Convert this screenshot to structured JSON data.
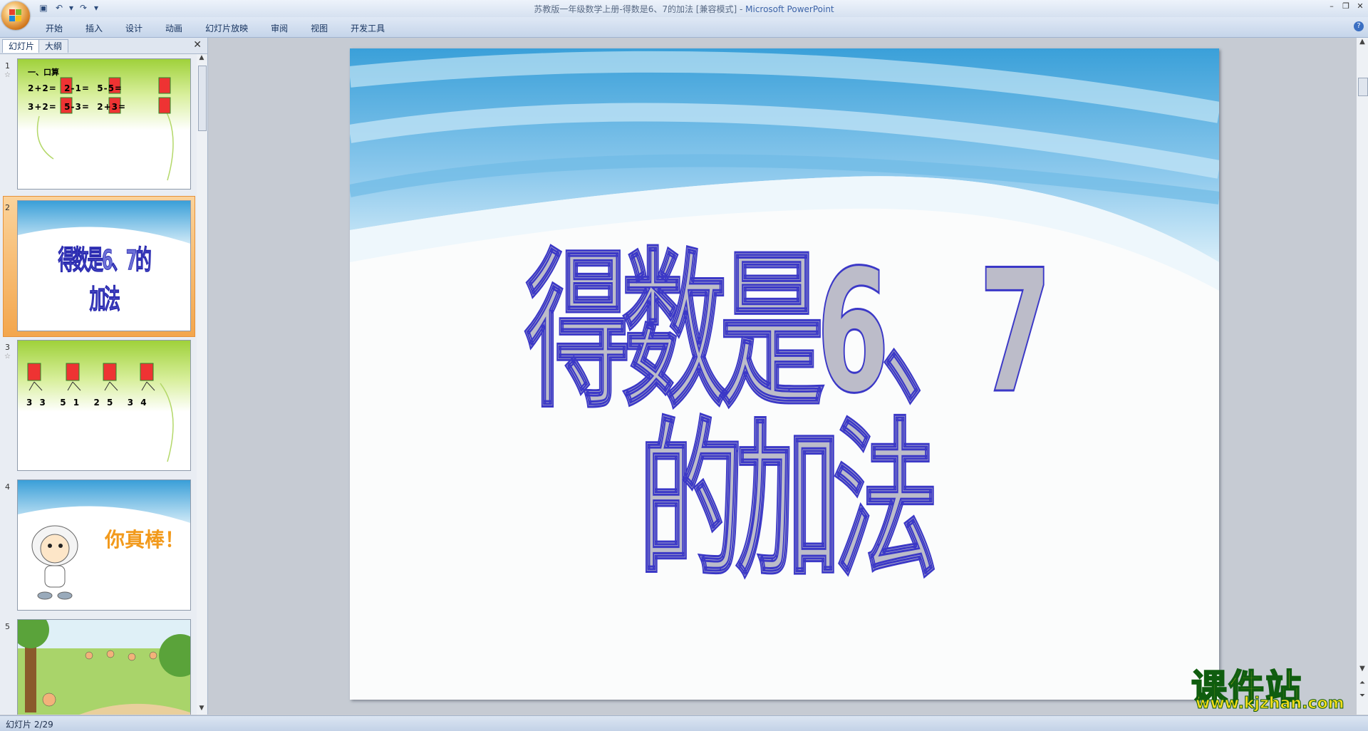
{
  "window": {
    "title": "苏教版一年级数学上册-得数是6、7的加法 [兼容模式] - ",
    "app_name": "Microsoft PowerPoint"
  },
  "ribbon": {
    "tabs": [
      "开始",
      "插入",
      "设计",
      "动画",
      "幻灯片放映",
      "审阅",
      "视图",
      "开发工具"
    ]
  },
  "left_pane": {
    "tabs": [
      "幻灯片",
      "大纲"
    ],
    "slides": [
      {
        "num": "1",
        "heading": "一、口算",
        "row1": "2+2=  2-1=  5-5=",
        "row2": "3+2=  5-3=  2+3="
      },
      {
        "num": "2",
        "title": "得数是6、7的加法"
      },
      {
        "num": "3",
        "row": "3 3  5 1  2 5  3 4"
      },
      {
        "num": "4",
        "text": "你真棒！"
      },
      {
        "num": "5"
      }
    ]
  },
  "slide": {
    "title": "得数是6、7的加法"
  },
  "status": {
    "slide_indicator": "幻灯片 2/29"
  },
  "watermark": {
    "brand": "课件站",
    "url": "www.kjzhan.com"
  }
}
